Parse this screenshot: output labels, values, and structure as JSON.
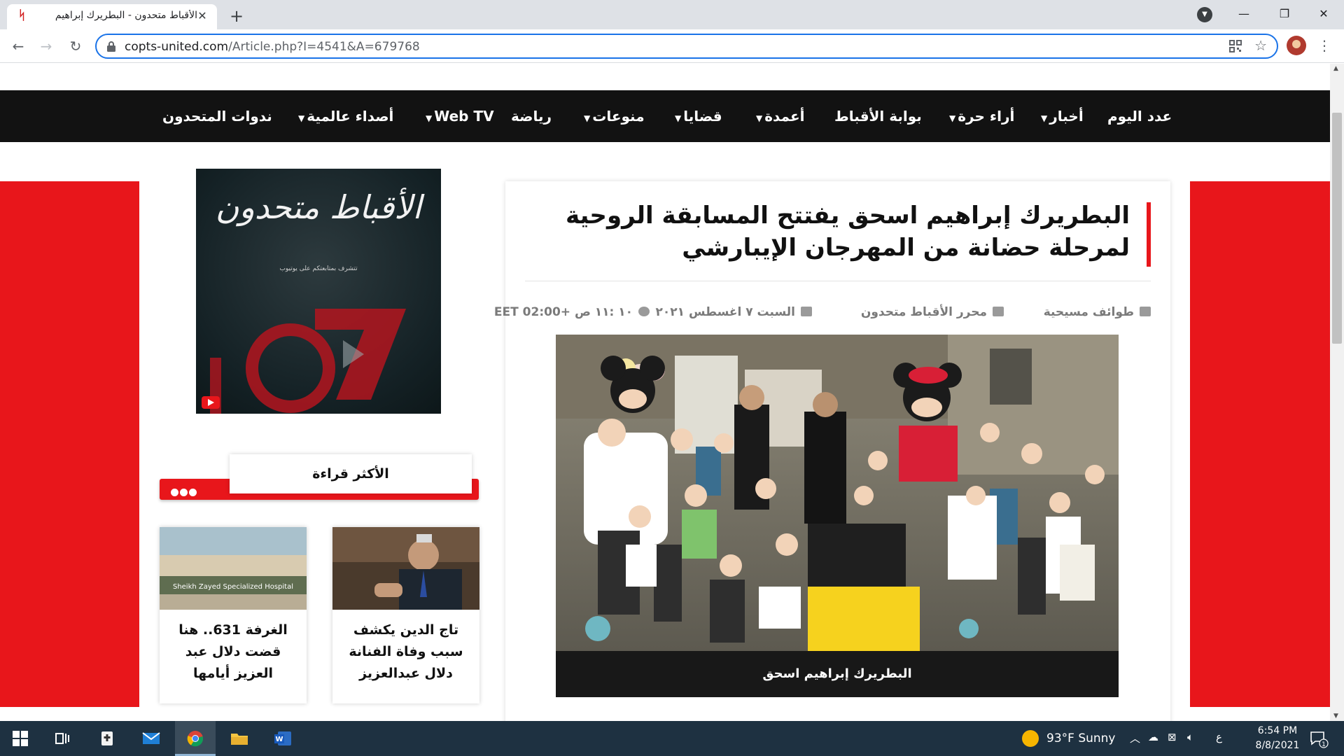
{
  "browser": {
    "tab_title": "الأقباط متحدون - البطريرك إبراهيم",
    "tab_close": "✕",
    "new_tab": "+",
    "url_host": "copts-united.com",
    "url_path": "/Article.php?I=4541&A=679768",
    "win_min": "—",
    "win_max": "❐",
    "win_close": "✕"
  },
  "nav": {
    "items": [
      {
        "label": "عدد اليوم",
        "caret": ""
      },
      {
        "label": "أخبار",
        "caret": "▼"
      },
      {
        "label": "أراء حرة",
        "caret": "▼"
      },
      {
        "label": "بوابة الأقباط",
        "caret": ""
      },
      {
        "label": "أعمدة",
        "caret": "▼"
      },
      {
        "label": "قضايا",
        "caret": "▼"
      },
      {
        "label": "منوعات",
        "caret": "▼"
      },
      {
        "label": "رياضة",
        "caret": ""
      },
      {
        "label": "Web TV",
        "caret": "▼"
      },
      {
        "label": "أصداء عالمية",
        "caret": "▼"
      },
      {
        "label": "ندوات المتحدون",
        "caret": ""
      }
    ]
  },
  "article": {
    "title": "البطريرك إبراهيم اسحق يفتتح المسابقة الروحية لمرحلة حضانة من المهرجان الإيبارشي",
    "category": "طوائف مسيحية",
    "author": "محرر الأقباط متحدون",
    "date": "السبت ٧ اغسطس ٢٠٢١",
    "time": "١٠ :١١ ص +02:00 EET",
    "caption": "البطريرك إبراهيم اسحق"
  },
  "sidebar": {
    "video_title": "الأقباط متحدون",
    "video_subtitle": "تتشرف بمتابعتكم على يوتيوب",
    "most_read_label": "الأكثر قراءة",
    "cards": [
      {
        "text": "تاج الدين يكشف سبب وفاة الفنانة دلال عبدالعزيز"
      },
      {
        "text": "الغرفة 631.. هنا قضت دلال عبد العزيز أيامها"
      }
    ],
    "hospital_sign": "Sheikh Zayed Specialized Hospital"
  },
  "taskbar": {
    "weather": "93°F  Sunny",
    "lang": "ع",
    "time": "6:54 PM",
    "date": "8/8/2021",
    "notif_count": "1"
  },
  "colors": {
    "accent_red": "#e8161b",
    "nav_bg": "#121212",
    "omnibox_focus": "#1a73e8",
    "taskbar_bg": "#1e3141"
  }
}
